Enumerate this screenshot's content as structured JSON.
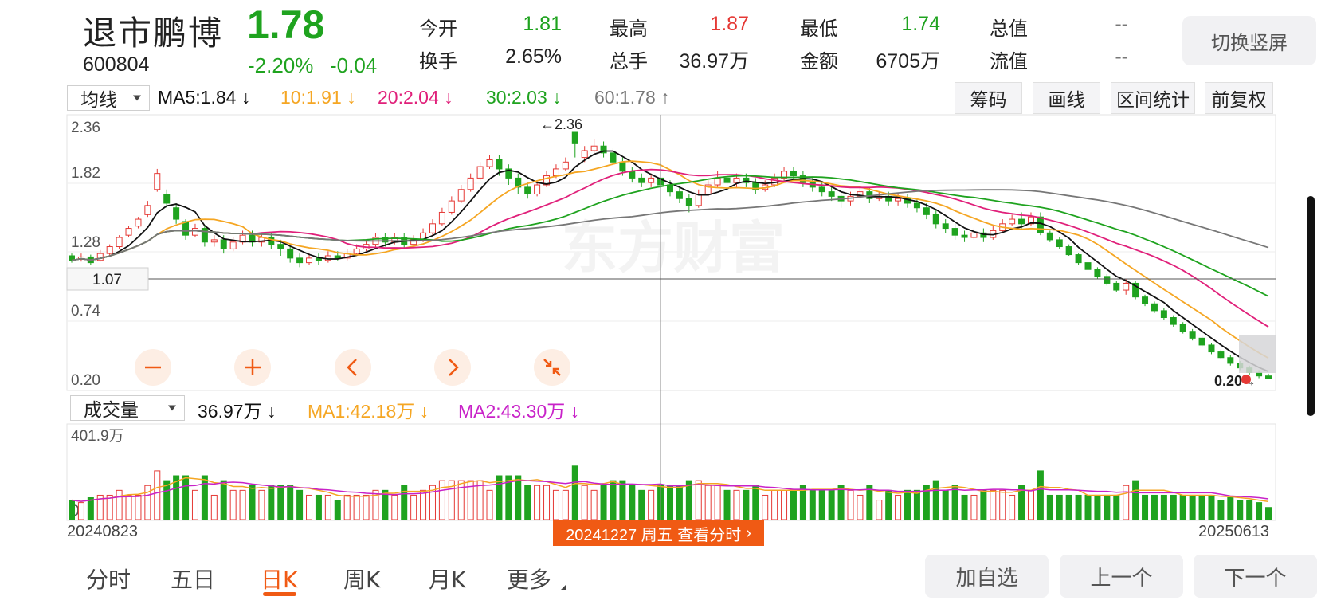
{
  "header": {
    "name": "退市鹏博",
    "price": "1.78",
    "code": "600804",
    "change_pct": "-2.20%",
    "change_amt": "-0.04",
    "switch_label": "切换竖屏"
  },
  "quotes": {
    "open_label": "今开",
    "open": "1.81",
    "high_label": "最高",
    "high": "1.87",
    "low_label": "最低",
    "low": "1.74",
    "mktcap_label": "总值",
    "mktcap": "--",
    "turnover_label": "换手",
    "turnover": "2.65%",
    "volume_label": "总手",
    "volume": "36.97万",
    "amount_label": "金额",
    "amount": "6705万",
    "float_label": "流值",
    "float": "--"
  },
  "ma_bar": {
    "selector": "均线",
    "ma5": "MA5:1.84",
    "ma10": "10:1.91",
    "ma20": "20:2.04",
    "ma30": "30:2.03",
    "ma60": "60:1.78",
    "colors": {
      "ma5": "#111111",
      "ma10": "#f5a623",
      "ma20": "#e0207a",
      "ma30": "#1fa31f",
      "ma60": "#777777"
    }
  },
  "tools": {
    "chips": "筹码",
    "draw": "画线",
    "range_stats": "区间统计",
    "adjust": "前复权"
  },
  "vol_bar": {
    "selector": "成交量",
    "vol": "36.97万",
    "ma1": "MA1:42.18万",
    "ma2": "MA2:43.30万",
    "colors": {
      "ma1": "#f5a623",
      "ma2": "#c822c8"
    }
  },
  "chart_data": {
    "type": "candlestick",
    "price_axis_labels": [
      "2.36",
      "1.82",
      "1.28",
      "0.74",
      "0.20"
    ],
    "ylim": [
      0.2,
      2.36
    ],
    "crosshair_price": "1.07",
    "max_label": "2.36",
    "min_label": "0.20",
    "vol_axis_max": "401.9万",
    "vol_axis_min": "0",
    "watermark": "东方财富",
    "ohlc_sketch": {
      "note_keys": [
        "o",
        "c",
        "h",
        "l"
      ],
      "points": [
        [
          1.28,
          1.24,
          1.3,
          1.22
        ],
        [
          1.25,
          1.27,
          1.3,
          1.23
        ],
        [
          1.27,
          1.22,
          1.29,
          1.2
        ],
        [
          1.24,
          1.3,
          1.33,
          1.23
        ],
        [
          1.3,
          1.36,
          1.38,
          1.28
        ],
        [
          1.36,
          1.44,
          1.46,
          1.34
        ],
        [
          1.46,
          1.52,
          1.54,
          1.44
        ],
        [
          1.54,
          1.6,
          1.62,
          1.52
        ],
        [
          1.64,
          1.72,
          1.76,
          1.62
        ],
        [
          1.86,
          2.0,
          2.04,
          1.84
        ],
        [
          1.82,
          1.74,
          1.86,
          1.7
        ],
        [
          1.7,
          1.6,
          1.74,
          1.56
        ],
        [
          1.58,
          1.46,
          1.6,
          1.42
        ],
        [
          1.46,
          1.52,
          1.56,
          1.44
        ],
        [
          1.52,
          1.4,
          1.54,
          1.36
        ],
        [
          1.4,
          1.42,
          1.46,
          1.36
        ],
        [
          1.42,
          1.34,
          1.46,
          1.3
        ],
        [
          1.34,
          1.4,
          1.44,
          1.32
        ],
        [
          1.4,
          1.46,
          1.5,
          1.38
        ],
        [
          1.46,
          1.4,
          1.5,
          1.36
        ],
        [
          1.4,
          1.44,
          1.48,
          1.36
        ],
        [
          1.44,
          1.38,
          1.48,
          1.34
        ],
        [
          1.38,
          1.34,
          1.42,
          1.28
        ],
        [
          1.34,
          1.26,
          1.36,
          1.22
        ],
        [
          1.26,
          1.22,
          1.3,
          1.18
        ],
        [
          1.22,
          1.26,
          1.3,
          1.2
        ],
        [
          1.26,
          1.24,
          1.3,
          1.2
        ],
        [
          1.24,
          1.28,
          1.32,
          1.22
        ],
        [
          1.28,
          1.26,
          1.32,
          1.24
        ],
        [
          1.26,
          1.3,
          1.34,
          1.24
        ],
        [
          1.3,
          1.34,
          1.38,
          1.28
        ],
        [
          1.34,
          1.38,
          1.42,
          1.32
        ],
        [
          1.38,
          1.44,
          1.48,
          1.36
        ],
        [
          1.44,
          1.4,
          1.48,
          1.36
        ],
        [
          1.4,
          1.44,
          1.48,
          1.38
        ],
        [
          1.44,
          1.38,
          1.48,
          1.34
        ],
        [
          1.38,
          1.42,
          1.46,
          1.36
        ],
        [
          1.42,
          1.48,
          1.52,
          1.4
        ],
        [
          1.48,
          1.56,
          1.6,
          1.46
        ],
        [
          1.56,
          1.66,
          1.7,
          1.54
        ],
        [
          1.66,
          1.76,
          1.8,
          1.64
        ],
        [
          1.76,
          1.86,
          1.9,
          1.74
        ],
        [
          1.86,
          1.96,
          2.0,
          1.84
        ],
        [
          1.96,
          2.06,
          2.1,
          1.94
        ],
        [
          2.06,
          2.12,
          2.16,
          2.04
        ],
        [
          2.12,
          2.04,
          2.16,
          1.98
        ],
        [
          2.04,
          1.96,
          2.08,
          1.9
        ],
        [
          1.96,
          1.88,
          2.0,
          1.82
        ],
        [
          1.88,
          1.82,
          1.92,
          1.78
        ],
        [
          1.82,
          1.9,
          1.94,
          1.8
        ],
        [
          1.9,
          1.98,
          2.02,
          1.88
        ],
        [
          1.98,
          2.04,
          2.08,
          1.96
        ],
        [
          2.04,
          2.1,
          2.14,
          2.02
        ],
        [
          2.36,
          2.26,
          2.36,
          2.14
        ],
        [
          2.14,
          2.2,
          2.24,
          2.1
        ],
        [
          2.2,
          2.24,
          2.3,
          2.18
        ],
        [
          2.24,
          2.18,
          2.28,
          2.14
        ],
        [
          2.18,
          2.1,
          2.22,
          2.06
        ],
        [
          2.1,
          2.02,
          2.14,
          1.98
        ],
        [
          2.02,
          1.96,
          2.06,
          1.92
        ],
        [
          1.96,
          1.92,
          2.0,
          1.88
        ],
        [
          1.92,
          1.96,
          2.0,
          1.88
        ],
        [
          1.96,
          1.9,
          2.0,
          1.86
        ],
        [
          1.9,
          1.84,
          1.94,
          1.8
        ],
        [
          1.84,
          1.78,
          1.88,
          1.74
        ],
        [
          1.78,
          1.72,
          1.82,
          1.66
        ],
        [
          1.72,
          1.82,
          1.86,
          1.7
        ],
        [
          1.82,
          1.9,
          1.94,
          1.8
        ],
        [
          1.9,
          1.96,
          2.02,
          1.88
        ],
        [
          1.96,
          1.92,
          2.0,
          1.88
        ],
        [
          1.92,
          1.96,
          2.0,
          1.88
        ],
        [
          1.96,
          1.92,
          2.0,
          1.88
        ],
        [
          1.92,
          1.86,
          1.96,
          1.82
        ],
        [
          1.86,
          1.9,
          1.94,
          1.84
        ],
        [
          1.9,
          1.96,
          2.0,
          1.88
        ],
        [
          1.96,
          2.02,
          2.06,
          1.94
        ],
        [
          2.02,
          1.98,
          2.06,
          1.94
        ],
        [
          1.98,
          1.92,
          2.02,
          1.88
        ],
        [
          1.92,
          1.88,
          1.96,
          1.84
        ],
        [
          1.88,
          1.84,
          1.92,
          1.8
        ],
        [
          1.84,
          1.8,
          1.88,
          1.76
        ],
        [
          1.8,
          1.76,
          1.84,
          1.7
        ],
        [
          1.76,
          1.8,
          1.84,
          1.72
        ],
        [
          1.8,
          1.84,
          1.88,
          1.78
        ],
        [
          1.84,
          1.78,
          1.88,
          1.74
        ],
        [
          1.78,
          1.8,
          1.84,
          1.76
        ],
        [
          1.8,
          1.76,
          1.84,
          1.72
        ],
        [
          1.76,
          1.78,
          1.82,
          1.72
        ],
        [
          1.78,
          1.74,
          1.82,
          1.7
        ],
        [
          1.74,
          1.7,
          1.78,
          1.66
        ],
        [
          1.7,
          1.64,
          1.74,
          1.6
        ],
        [
          1.64,
          1.56,
          1.68,
          1.52
        ],
        [
          1.56,
          1.52,
          1.6,
          1.48
        ],
        [
          1.52,
          1.46,
          1.56,
          1.42
        ],
        [
          1.46,
          1.44,
          1.5,
          1.4
        ],
        [
          1.44,
          1.48,
          1.52,
          1.42
        ],
        [
          1.48,
          1.44,
          1.52,
          1.4
        ],
        [
          1.44,
          1.5,
          1.54,
          1.42
        ],
        [
          1.5,
          1.56,
          1.6,
          1.48
        ],
        [
          1.56,
          1.6,
          1.64,
          1.54
        ],
        [
          1.6,
          1.56,
          1.66,
          1.52
        ],
        [
          1.56,
          1.62,
          1.66,
          1.54
        ],
        [
          1.62,
          1.48,
          1.66,
          1.46
        ],
        [
          1.48,
          1.42,
          1.5,
          1.4
        ],
        [
          1.42,
          1.36,
          1.44,
          1.34
        ],
        [
          1.36,
          1.29,
          1.38,
          1.28
        ],
        [
          1.29,
          1.22,
          1.3,
          1.2
        ],
        [
          1.22,
          1.16,
          1.24,
          1.14
        ],
        [
          1.16,
          1.1,
          1.18,
          1.08
        ],
        [
          1.1,
          1.04,
          1.12,
          1.02
        ],
        [
          1.04,
          0.98,
          1.06,
          0.96
        ],
        [
          0.98,
          1.04,
          1.08,
          0.94
        ],
        [
          1.04,
          0.92,
          1.06,
          0.9
        ],
        [
          0.92,
          0.86,
          0.94,
          0.84
        ],
        [
          0.86,
          0.8,
          0.88,
          0.78
        ],
        [
          0.8,
          0.74,
          0.82,
          0.72
        ],
        [
          0.74,
          0.68,
          0.76,
          0.66
        ],
        [
          0.68,
          0.62,
          0.7,
          0.6
        ],
        [
          0.62,
          0.56,
          0.64,
          0.54
        ],
        [
          0.56,
          0.5,
          0.58,
          0.48
        ],
        [
          0.5,
          0.44,
          0.52,
          0.42
        ],
        [
          0.44,
          0.39,
          0.46,
          0.38
        ],
        [
          0.39,
          0.34,
          0.41,
          0.32
        ],
        [
          0.34,
          0.3,
          0.36,
          0.28
        ],
        [
          0.3,
          0.26,
          0.32,
          0.24
        ],
        [
          0.26,
          0.23,
          0.28,
          0.21
        ],
        [
          0.23,
          0.21,
          0.25,
          0.2
        ]
      ]
    }
  },
  "footer": {
    "start_date": "20240823",
    "end_date": "20250613",
    "selected": "20241227 周五 查看分时",
    "tabs": [
      "分时",
      "五日",
      "日K",
      "周K",
      "月K",
      "更多"
    ],
    "add_watch": "加自选",
    "prev": "上一个",
    "next": "下一个"
  }
}
